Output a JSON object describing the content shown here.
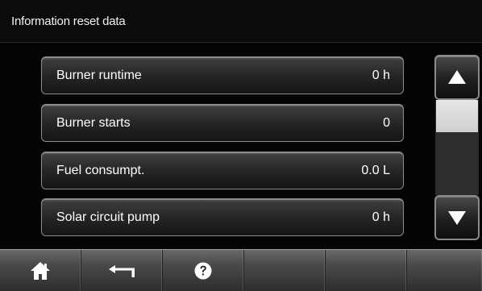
{
  "header": {
    "title": "Information reset data"
  },
  "list": {
    "items": [
      {
        "label": "Burner runtime",
        "value": "0 h"
      },
      {
        "label": "Burner starts",
        "value": "0"
      },
      {
        "label": "Fuel consumpt.",
        "value": "0.0 L"
      },
      {
        "label": "Solar circuit pump",
        "value": "0 h"
      }
    ]
  },
  "scrollbar": {
    "up_icon": "arrow-up-icon",
    "down_icon": "arrow-down-icon",
    "thumb_color": "#d8d8d8"
  },
  "toolbar": {
    "buttons": [
      {
        "icon": "home-icon"
      },
      {
        "icon": "back-arrow-icon"
      },
      {
        "icon": "help-icon"
      },
      {
        "icon": ""
      },
      {
        "icon": ""
      },
      {
        "icon": ""
      }
    ]
  }
}
